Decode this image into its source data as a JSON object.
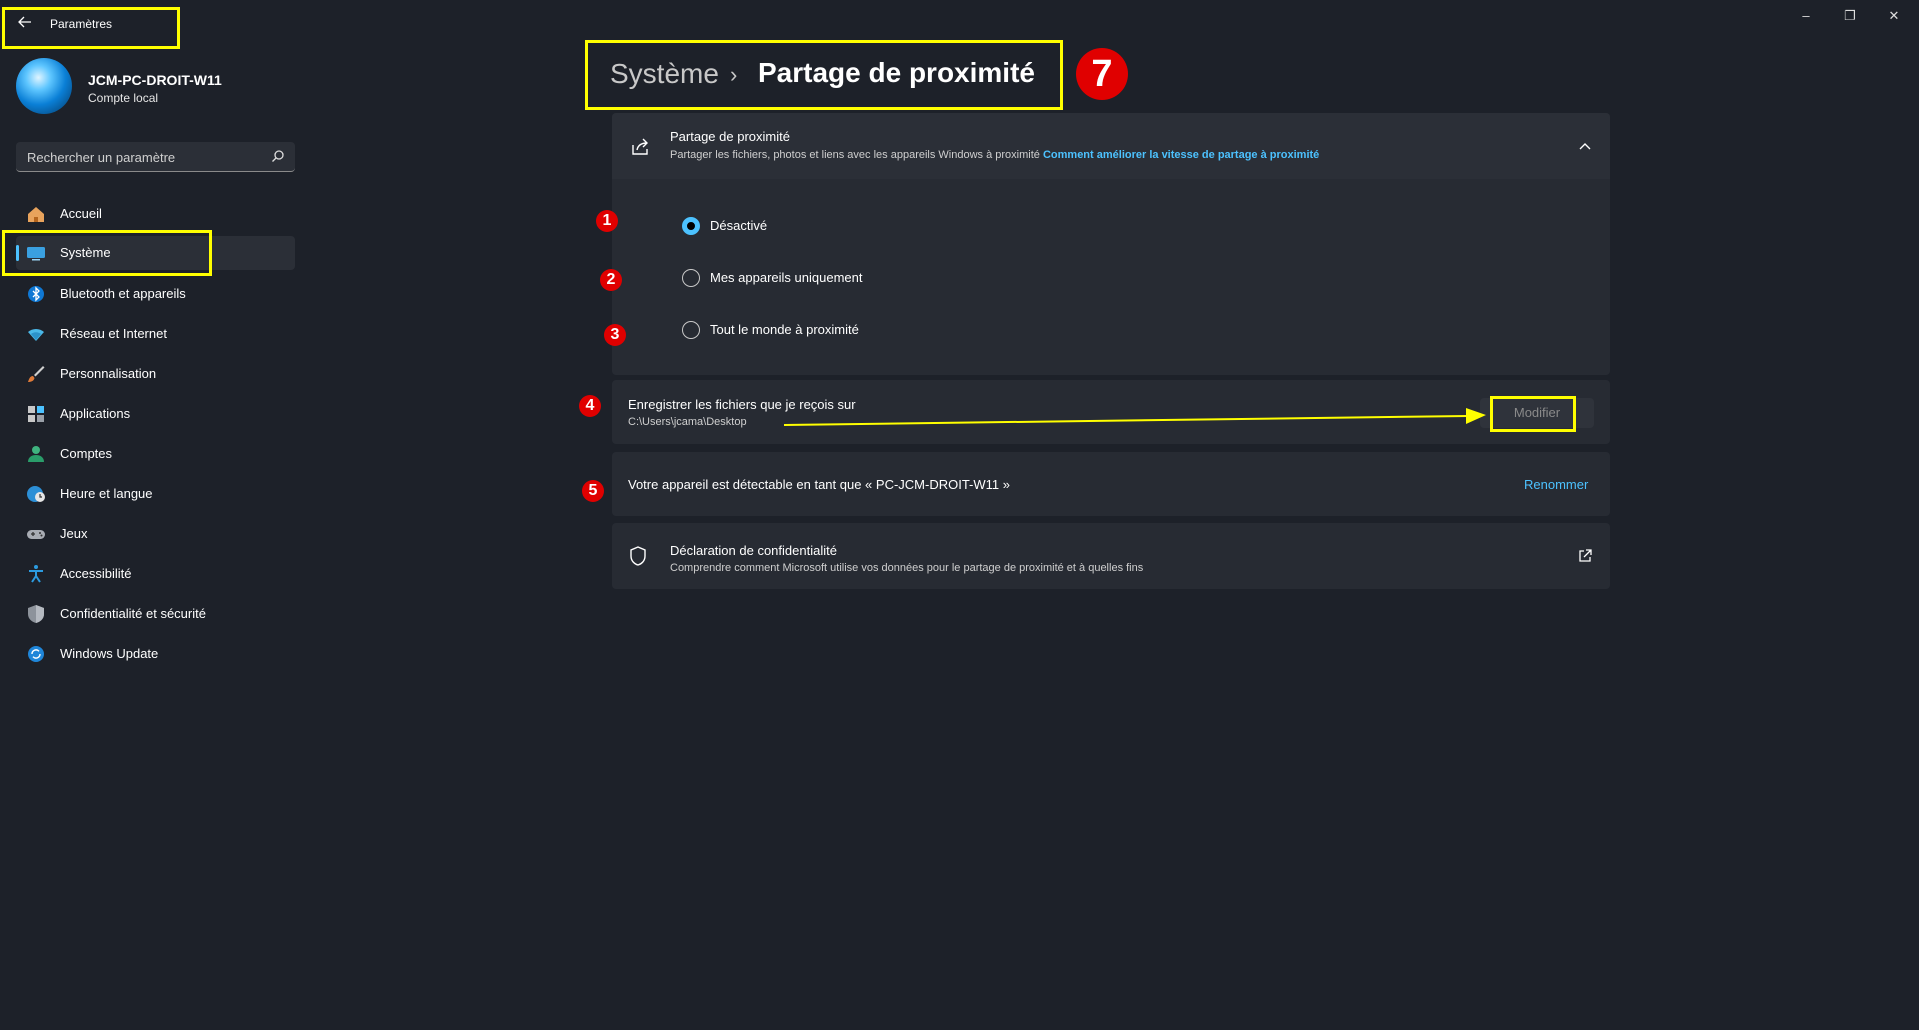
{
  "window": {
    "title": "Paramètres",
    "controls": [
      "–",
      "❐",
      "✕"
    ]
  },
  "profile": {
    "pc_name": "JCM-PC-DROIT-W11",
    "account_type": "Compte local"
  },
  "search": {
    "placeholder": "Rechercher un paramètre"
  },
  "sidebar": {
    "items": [
      {
        "label": "Accueil",
        "icon": "home-icon"
      },
      {
        "label": "Système",
        "icon": "display-icon",
        "selected": true
      },
      {
        "label": "Bluetooth et appareils",
        "icon": "bluetooth-icon"
      },
      {
        "label": "Réseau et Internet",
        "icon": "wifi-icon"
      },
      {
        "label": "Personnalisation",
        "icon": "brush-icon"
      },
      {
        "label": "Applications",
        "icon": "apps-icon"
      },
      {
        "label": "Comptes",
        "icon": "person-icon"
      },
      {
        "label": "Heure et langue",
        "icon": "globe-clock-icon"
      },
      {
        "label": "Jeux",
        "icon": "gamepad-icon"
      },
      {
        "label": "Accessibilité",
        "icon": "accessibility-icon"
      },
      {
        "label": "Confidentialité et sécurité",
        "icon": "shield-icon"
      },
      {
        "label": "Windows Update",
        "icon": "update-icon"
      }
    ]
  },
  "breadcrumb": {
    "root": "Système",
    "separator": "›",
    "current": "Partage de proximité"
  },
  "nearby_sharing": {
    "title": "Partage de proximité",
    "subtitle": "Partager les fichiers, photos et liens avec les appareils Windows à proximité",
    "link": "Comment améliorer la vitesse de partage à proximité",
    "options": [
      {
        "label": "Désactivé",
        "checked": true
      },
      {
        "label": "Mes appareils uniquement",
        "checked": false
      },
      {
        "label": "Tout le monde à proximité",
        "checked": false
      }
    ]
  },
  "save_location": {
    "title": "Enregistrer les fichiers que je reçois sur",
    "path": "C:\\Users\\jcama\\Desktop",
    "button": "Modifier"
  },
  "device_name": {
    "text": "Votre appareil est détectable en tant que « PC-JCM-DROIT-W11 »",
    "button": "Renommer"
  },
  "privacy": {
    "title": "Déclaration de confidentialité",
    "subtitle": "Comprendre comment Microsoft utilise vos données pour le partage de proximité et à quelles fins"
  },
  "annotations": {
    "badges": [
      "1",
      "2",
      "3",
      "4",
      "5",
      "7"
    ],
    "colors": {
      "highlight": "#ffff00",
      "badge": "#e00000",
      "accent": "#4cc2ff"
    }
  }
}
